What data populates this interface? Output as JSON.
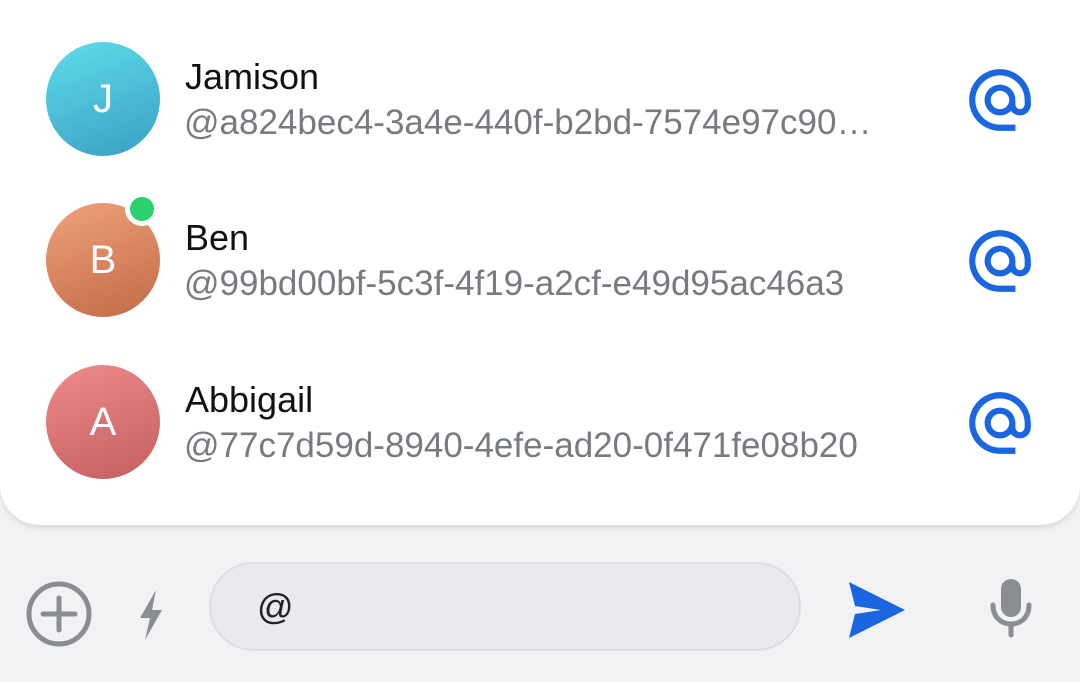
{
  "mention_suggestions": [
    {
      "initial": "J",
      "name": "Jamison",
      "handle": "@a824bec4-3a4e-440f-b2bd-7574e97c90…",
      "online": false,
      "avatar_color": "#4cc3dd"
    },
    {
      "initial": "B",
      "name": "Ben",
      "handle": "@99bd00bf-5c3f-4f19-a2cf-e49d95ac46a3",
      "online": true,
      "avatar_color": "#db8760"
    },
    {
      "initial": "A",
      "name": "Abbigail",
      "handle": "@77c7d59d-8940-4efe-ad20-0f471fe08b20",
      "online": false,
      "avatar_color": "#d87576"
    }
  ],
  "composer": {
    "input_value": "@",
    "icons": {
      "attach": "plus-circle-icon",
      "quick_action": "lightning-icon",
      "send": "send-icon",
      "voice": "microphone-icon",
      "mention": "at-sign-icon"
    }
  },
  "colors": {
    "accent": "#1a66e0",
    "presence_online": "#2ad16f",
    "icon_gray": "#8a8d92"
  }
}
